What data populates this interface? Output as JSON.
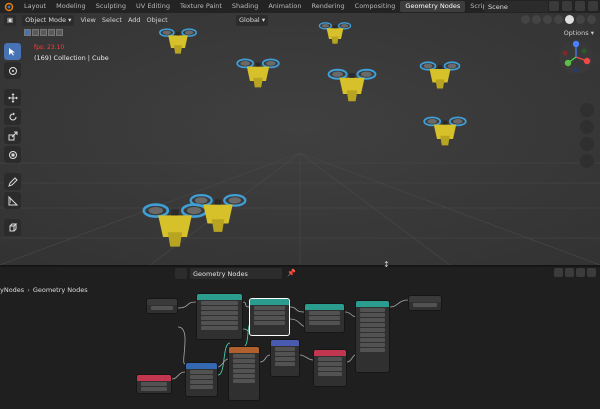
{
  "topbar": {
    "workspace_tabs": [
      {
        "label": "Layout",
        "active": false
      },
      {
        "label": "Modeling",
        "active": false
      },
      {
        "label": "Sculpting",
        "active": false
      },
      {
        "label": "UV Editing",
        "active": false
      },
      {
        "label": "Texture Paint",
        "active": false
      },
      {
        "label": "Shading",
        "active": false
      },
      {
        "label": "Animation",
        "active": false
      },
      {
        "label": "Rendering",
        "active": false
      },
      {
        "label": "Compositing",
        "active": false
      },
      {
        "label": "Geometry Nodes",
        "active": true
      },
      {
        "label": "Scripting",
        "active": false
      }
    ],
    "add_workspace": "+",
    "scene": "Scene"
  },
  "viewport": {
    "mode": "Object Mode",
    "menus": [
      "View",
      "Select",
      "Add",
      "Object"
    ],
    "transform_orientation": "Global",
    "options_label": "Options",
    "fps": "fps: 23.10",
    "collection_info": "(169) Collection | Cube",
    "colors": {
      "fps": "#ff3b3b",
      "accent": "#4772b3",
      "drone_body": "#d6c12a",
      "propeller": "#3f9fd6"
    }
  },
  "node_editor": {
    "tree_name": "Geometry Nodes",
    "breadcrumb": [
      "yNodes",
      "Geometry Nodes"
    ]
  }
}
